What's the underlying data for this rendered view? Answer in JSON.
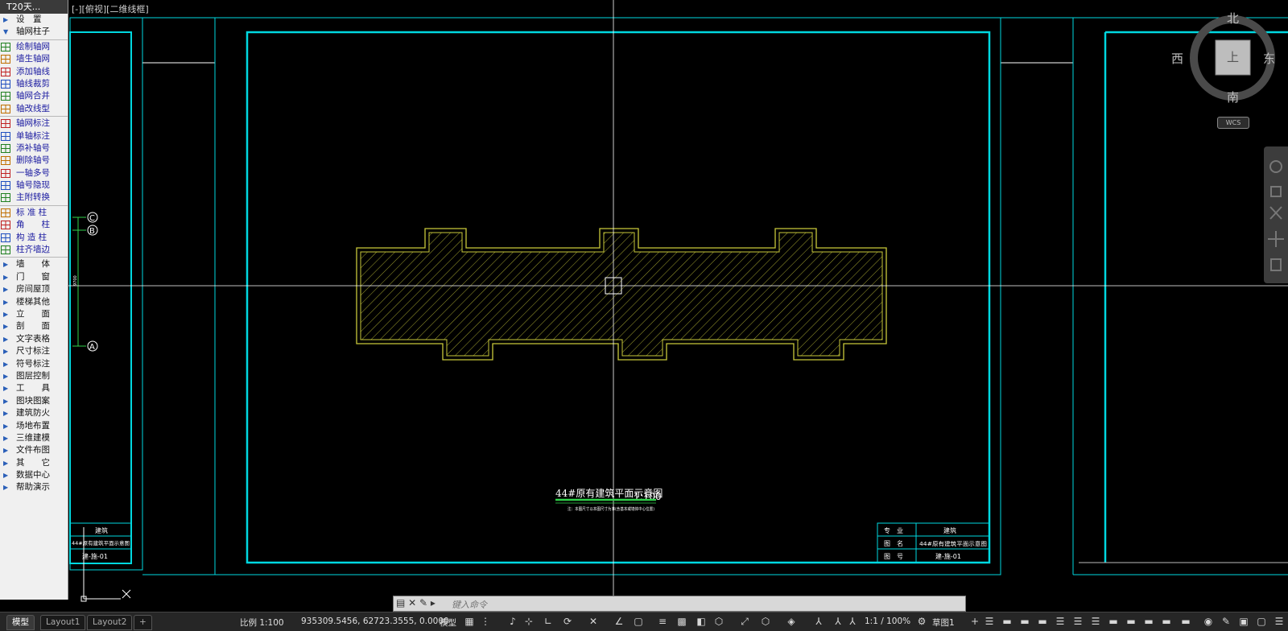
{
  "app": {
    "palette_title": "T20天...",
    "viewport_label": "[-][俯视][二维线框]"
  },
  "palette": {
    "items": [
      {
        "label": "设　置",
        "kind": "menu",
        "arrow": "right"
      },
      {
        "label": "轴网柱子",
        "kind": "menu",
        "arrow": "down"
      },
      {
        "label": "绘制轴网",
        "kind": "tool"
      },
      {
        "label": "墙生轴网",
        "kind": "tool"
      },
      {
        "label": "添加轴线",
        "kind": "tool"
      },
      {
        "label": "轴线裁剪",
        "kind": "tool"
      },
      {
        "label": "轴网合并",
        "kind": "tool"
      },
      {
        "label": "轴改线型",
        "kind": "tool"
      },
      {
        "label": "轴网标注",
        "kind": "tool"
      },
      {
        "label": "单轴标注",
        "kind": "tool"
      },
      {
        "label": "添补轴号",
        "kind": "tool"
      },
      {
        "label": "删除轴号",
        "kind": "tool"
      },
      {
        "label": "一轴多号",
        "kind": "tool"
      },
      {
        "label": "轴号隐现",
        "kind": "tool"
      },
      {
        "label": "主附转换",
        "kind": "tool"
      },
      {
        "label": "标 准 柱",
        "kind": "tool"
      },
      {
        "label": "角　　柱",
        "kind": "tool"
      },
      {
        "label": "构 造 柱",
        "kind": "tool"
      },
      {
        "label": "柱齐墙边",
        "kind": "tool"
      },
      {
        "label": "墙　　体",
        "kind": "menu",
        "arrow": "right"
      },
      {
        "label": "门　　窗",
        "kind": "menu",
        "arrow": "right"
      },
      {
        "label": "房间屋顶",
        "kind": "menu",
        "arrow": "right"
      },
      {
        "label": "楼梯其他",
        "kind": "menu",
        "arrow": "right"
      },
      {
        "label": "立　　面",
        "kind": "menu",
        "arrow": "right"
      },
      {
        "label": "剖　　面",
        "kind": "menu",
        "arrow": "right"
      },
      {
        "label": "文字表格",
        "kind": "menu",
        "arrow": "right"
      },
      {
        "label": "尺寸标注",
        "kind": "menu",
        "arrow": "right"
      },
      {
        "label": "符号标注",
        "kind": "menu",
        "arrow": "right"
      },
      {
        "label": "图层控制",
        "kind": "menu",
        "arrow": "right"
      },
      {
        "label": "工　　具",
        "kind": "menu",
        "arrow": "right"
      },
      {
        "label": "图块图案",
        "kind": "menu",
        "arrow": "right"
      },
      {
        "label": "建筑防火",
        "kind": "menu",
        "arrow": "right"
      },
      {
        "label": "场地布置",
        "kind": "menu",
        "arrow": "right"
      },
      {
        "label": "三维建模",
        "kind": "menu",
        "arrow": "right"
      },
      {
        "label": "文件布图",
        "kind": "menu",
        "arrow": "right"
      },
      {
        "label": "其　　它",
        "kind": "menu",
        "arrow": "right"
      },
      {
        "label": "数据中心",
        "kind": "menu",
        "arrow": "right"
      },
      {
        "label": "帮助演示",
        "kind": "menu",
        "arrow": "right"
      }
    ]
  },
  "drawing": {
    "axis_bubbles": [
      "C",
      "B",
      "A"
    ],
    "axis_dim": "9700",
    "plan_title": "44#原有建筑平面示意图",
    "plan_scale": "1:100",
    "plan_note": "注：本图尺寸以本图尺寸为准(含基本或墙体中心位置)",
    "left_title_block": {
      "profession": "建筑",
      "name": "44#原有建筑平面示意图",
      "number": "建-施-01"
    },
    "title_block": {
      "profession_label": "专　业",
      "profession": "建筑",
      "name_label": "图　名",
      "name": "44#原有建筑平面示意图",
      "number_label": "图　号",
      "number": "建-施-01"
    },
    "colors": {
      "frame": "#00d8e0",
      "hatch": "#c9c93a",
      "axis": "#2fd04a",
      "white": "#ffffff"
    }
  },
  "viewcube": {
    "north": "北",
    "south": "南",
    "east": "东",
    "west": "西",
    "face": "上",
    "wcs": "WCS"
  },
  "cmd": {
    "placeholder": "键入命令"
  },
  "status": {
    "tabs": [
      "模型",
      "Layout1",
      "Layout2",
      "+"
    ],
    "scale": "比例 1:100",
    "coords": "935309.5456, 62723.3555, 0.0000",
    "space": "模型",
    "annotation_scale": "1:1 / 100%",
    "workspace": "草图1"
  }
}
